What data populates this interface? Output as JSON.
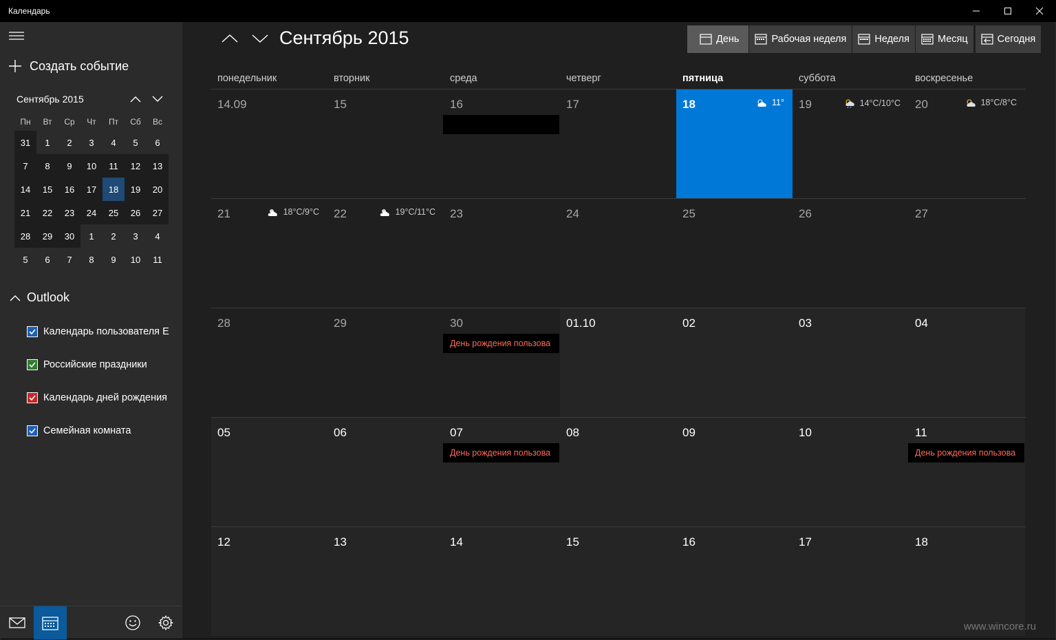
{
  "app": {
    "title": "Календарь"
  },
  "sidebar": {
    "new_event_label": "Создать событие",
    "mini_calendar": {
      "title": "Сентябрь 2015",
      "dow": [
        "Пн",
        "Вт",
        "Ср",
        "Чт",
        "Пт",
        "Сб",
        "Вс"
      ],
      "weeks": [
        [
          "31",
          "1",
          "2",
          "3",
          "4",
          "5",
          "6"
        ],
        [
          "7",
          "8",
          "9",
          "10",
          "11",
          "12",
          "13"
        ],
        [
          "14",
          "15",
          "16",
          "17",
          "18",
          "19",
          "20"
        ],
        [
          "21",
          "22",
          "23",
          "24",
          "25",
          "26",
          "27"
        ],
        [
          "28",
          "29",
          "30",
          "1",
          "2",
          "3",
          "4"
        ],
        [
          "5",
          "6",
          "7",
          "8",
          "9",
          "10",
          "11"
        ]
      ]
    },
    "account": {
      "name": "Outlook"
    },
    "calendars": [
      {
        "label": "Календарь пользователя Е",
        "color": "#1e5fb4"
      },
      {
        "label": "Российские праздники",
        "color": "#2e7d32"
      },
      {
        "label": "Календарь дней рождения",
        "color": "#c62828"
      },
      {
        "label": "Семейная комната",
        "color": "#1e5fb4"
      }
    ]
  },
  "main": {
    "month_title": "Сентябрь 2015",
    "views": {
      "day": "День",
      "work_week": "Рабочая неделя",
      "week": "Неделя",
      "month": "Месяц",
      "today": "Сегодня"
    },
    "dow": [
      "понедельник",
      "вторник",
      "среда",
      "четверг",
      "пятница",
      "суббота",
      "воскресенье"
    ],
    "weeks": [
      [
        {
          "d": "14.09"
        },
        {
          "d": "15"
        },
        {
          "d": "16"
        },
        {
          "d": "17"
        },
        {
          "d": "18",
          "w": "11°"
        },
        {
          "d": "19",
          "w": "14°C/10°C"
        },
        {
          "d": "20",
          "w": "18°C/8°C"
        }
      ],
      [
        {
          "d": "21",
          "w": "18°C/9°C"
        },
        {
          "d": "22",
          "w": "19°C/11°C"
        },
        {
          "d": "23"
        },
        {
          "d": "24"
        },
        {
          "d": "25"
        },
        {
          "d": "26"
        },
        {
          "d": "27"
        }
      ],
      [
        {
          "d": "28"
        },
        {
          "d": "29"
        },
        {
          "d": "30",
          "e": "День рождения пользова"
        },
        {
          "d": "01.10"
        },
        {
          "d": "02"
        },
        {
          "d": "03"
        },
        {
          "d": "04"
        }
      ],
      [
        {
          "d": "05"
        },
        {
          "d": "06"
        },
        {
          "d": "07",
          "e": "День рождения пользова"
        },
        {
          "d": "08"
        },
        {
          "d": "09"
        },
        {
          "d": "10"
        },
        {
          "d": "11",
          "e": "День рождения пользова"
        }
      ],
      [
        {
          "d": "12"
        },
        {
          "d": "13"
        },
        {
          "d": "14"
        },
        {
          "d": "15"
        },
        {
          "d": "16"
        },
        {
          "d": "17"
        },
        {
          "d": "18"
        }
      ]
    ]
  },
  "watermark": "www.wincore.ru",
  "colors": {
    "accent": "#0078d7",
    "today_mini": "#1e4a75",
    "event_text": "#ff6b5a"
  }
}
